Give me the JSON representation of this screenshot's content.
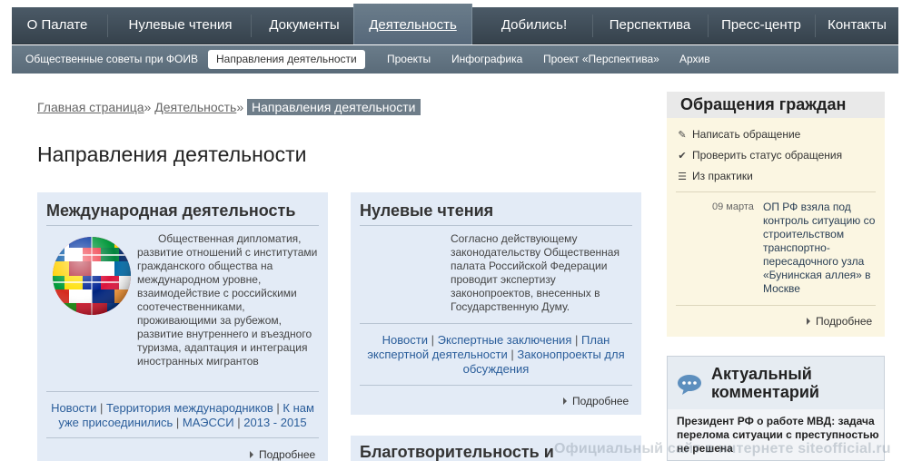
{
  "topnav": {
    "items": [
      {
        "label": "О Палате"
      },
      {
        "label": "Нулевые чтения"
      },
      {
        "label": "Документы"
      },
      {
        "label": "Деятельность",
        "active": true
      },
      {
        "label": "Добились!"
      },
      {
        "label": "Перспектива"
      },
      {
        "label": "Пресс-центр"
      },
      {
        "label": "Контакты"
      }
    ]
  },
  "subnav": {
    "items": [
      {
        "label": "Общественные советы при ФОИВ"
      },
      {
        "label": "Направления деятельности",
        "active": true
      },
      {
        "label": "Проекты"
      },
      {
        "label": "Инфографика"
      },
      {
        "label": "Проект «Перспектива»"
      },
      {
        "label": "Архив"
      }
    ]
  },
  "breadcrumb": {
    "home": "Главная страница",
    "sep1": "»",
    "section": "Деятельность",
    "sep2": "»",
    "current": "Направления деятельности"
  },
  "page_title": "Направления деятельности",
  "cards": {
    "international": {
      "title": "Международная деятельность",
      "text": "Общественная дипломатия, развитие отношений с институтами гражданского общества на международном уровне, взаимодействие с российскими соотечественниками, проживающими за рубежом, развитие внутреннего и въездного туризма, адаптация и интеграция иностранных мигрантов",
      "links": [
        "Новости",
        "Территория международников",
        "К нам уже присоединились",
        "МАЭССИ",
        "2013 - 2015"
      ],
      "separator": "|",
      "more": "Подробнее"
    },
    "zero_readings": {
      "title": "Нулевые чтения",
      "text": "Согласно действующему законодательству Общественная палата Российской Федерации проводит экспертизу законопроектов, внесенных в Государственную Думу.",
      "links": [
        "Новости",
        "Экспертные заключения",
        "План экспертной деятельности",
        "Законопроекты для обсуждения"
      ],
      "separator": "|",
      "more": "Подробнее"
    },
    "charity": {
      "title": "Благотворительность и"
    }
  },
  "sidebar": {
    "appeals": {
      "title": "Обращения граждан",
      "links": [
        {
          "label": "Написать обращение",
          "icon": "pencil-icon"
        },
        {
          "label": "Проверить статус обращения",
          "icon": "check-icon"
        },
        {
          "label": "Из практики",
          "icon": "list-icon"
        }
      ],
      "news": {
        "date": "09 марта",
        "text": "ОП РФ взяла под контроль ситуацию со строительством транспортно-пересадочного узла «Бунинская аллея» в Москве"
      },
      "more": "Подробнее"
    },
    "comment": {
      "title_line1": "Актуальный",
      "title_line2": "комментарий",
      "icon": "speech-bubble-icon",
      "text": "Президент РФ о работе МВД: задача перелома ситуации с преступностью не решена"
    }
  },
  "watermark": "Официальный сайт в интернете siteofficial.ru",
  "colors": {
    "topnav": "#3f4c57",
    "subnav": "#62737f",
    "card_bg": "#e3ebf6",
    "appeals_bg": "#fbf6e2",
    "link": "#2a5d9a"
  }
}
